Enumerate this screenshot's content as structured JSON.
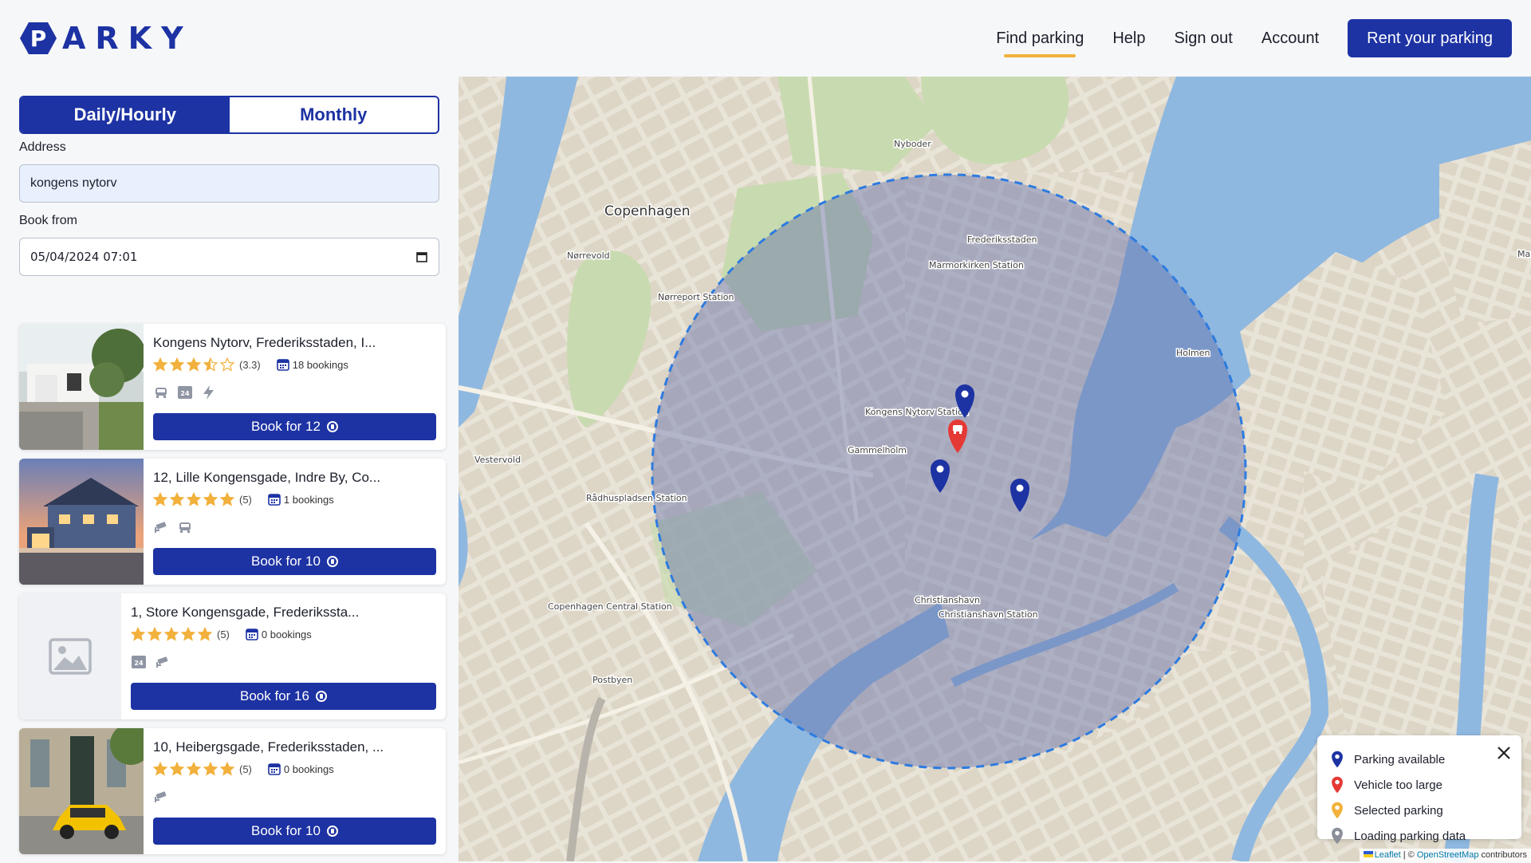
{
  "brand": {
    "name": "ARKY",
    "logo_letter": "P",
    "color": "#1d32a3"
  },
  "nav": {
    "items": [
      {
        "label": "Find parking",
        "active": true
      },
      {
        "label": "Help",
        "active": false
      },
      {
        "label": "Sign out",
        "active": false
      },
      {
        "label": "Account",
        "active": false
      }
    ],
    "cta": "Rent your parking"
  },
  "search": {
    "tabs": [
      "Daily/Hourly",
      "Monthly"
    ],
    "selected_tab": "Daily/Hourly",
    "address_label": "Address",
    "address_value": "kongens nytorv",
    "book_from_label": "Book from",
    "book_from_value": "05/04/2024 07:01"
  },
  "listings": [
    {
      "title": "Kongens Nytorv, Frederiksstaden, I...",
      "rating": 3.3,
      "rating_text": "(3.3)",
      "bookings": "18 bookings",
      "features": [
        "car-icon",
        "24h-icon",
        "ev-charging-icon"
      ],
      "button": "Book for 12",
      "image": "white-modern-house"
    },
    {
      "title": "12, Lille Kongensgade, Indre By, Co...",
      "rating": 5,
      "rating_text": "(5)",
      "bookings": "1 bookings",
      "features": [
        "cctv-icon",
        "car-icon"
      ],
      "button": "Book for 10",
      "image": "blue-house-dusk"
    },
    {
      "title": "1, Store Kongensgade, Frederikssta...",
      "rating": 5,
      "rating_text": "(5)",
      "bookings": "0 bookings",
      "features": [
        "24h-icon",
        "cctv-icon"
      ],
      "button": "Book for 16",
      "image": "placeholder"
    },
    {
      "title": "10, Heibergsgade, Frederiksstaden, ...",
      "rating": 5,
      "rating_text": "(5)",
      "bookings": "0 bookings",
      "features": [
        "cctv-icon"
      ],
      "button": "Book for 10",
      "image": "yellow-mini-car"
    }
  ],
  "map": {
    "labels": [
      "Copenhagen",
      "Nørrevold",
      "Nyboder",
      "Frederiksstaden",
      "Marmorkirken Station",
      "Nørreport Station",
      "Kongens Nytorv Station",
      "Gammelholm",
      "Holmen",
      "Vestervold",
      "Rådhuspladsen Station",
      "Copenhagen Central Station",
      "Christianshavn",
      "Christianshavn Station",
      "Postbyen",
      "Marg"
    ],
    "legend": [
      {
        "label": "Parking available",
        "color": "#1d32a3"
      },
      {
        "label": "Vehicle too large",
        "color": "#e53935"
      },
      {
        "label": "Selected parking",
        "color": "#f2b13c"
      },
      {
        "label": "Loading parking data",
        "color": "#8a8f99"
      }
    ],
    "attribution": {
      "leaflet": "Leaflet",
      "sep": " | © ",
      "osm": "OpenStreetMap",
      "suffix": " contributors"
    },
    "colors": {
      "water": "#8fb8e0",
      "park": "#c8dbb0",
      "land": "#e9e4d8",
      "block": "#d8d2c4",
      "radius_fill": "rgba(100,110,170,0.45)",
      "radius_stroke": "#2d7be0"
    }
  }
}
